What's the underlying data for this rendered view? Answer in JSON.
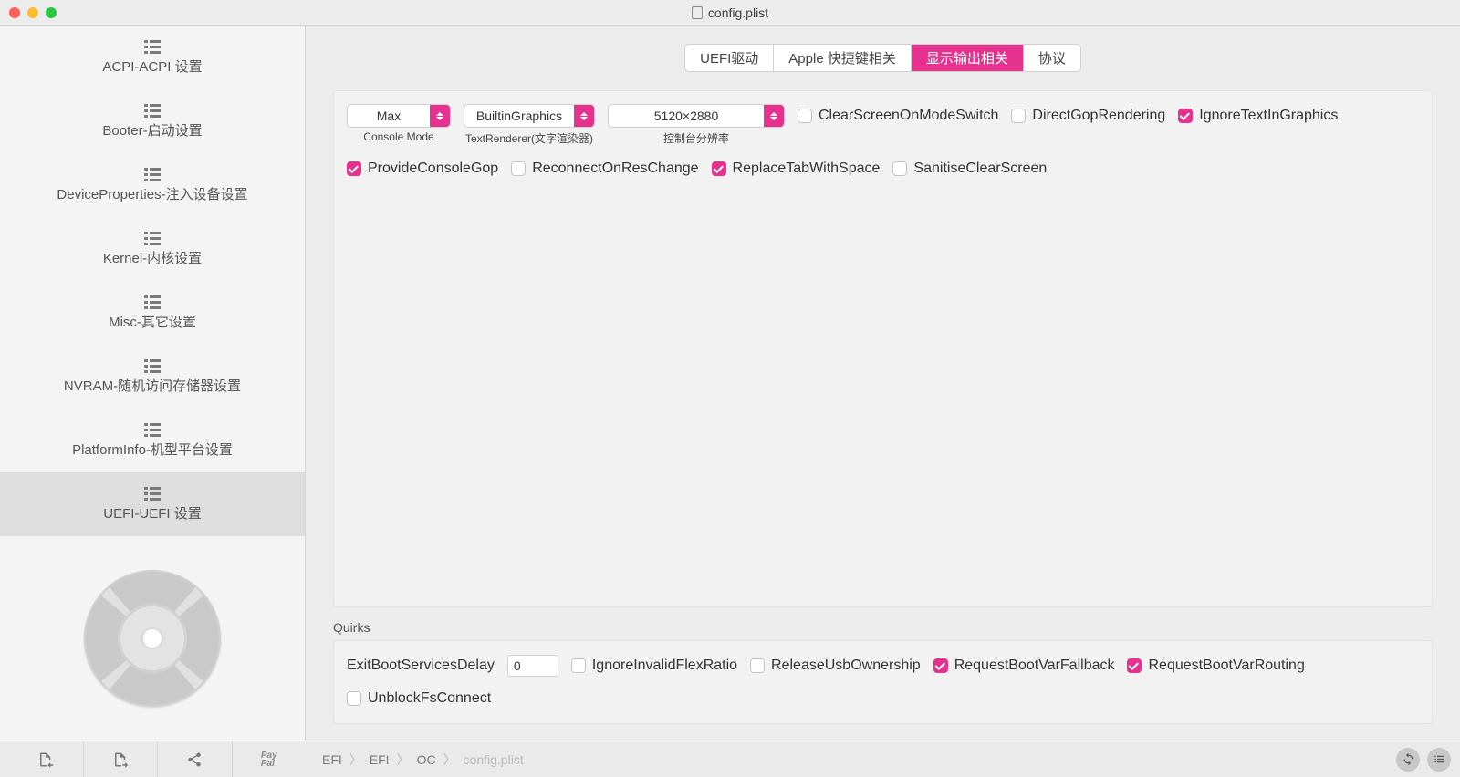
{
  "window": {
    "title": "config.plist"
  },
  "sidebar": {
    "items": [
      {
        "label": "ACPI-ACPI 设置"
      },
      {
        "label": "Booter-启动设置"
      },
      {
        "label": "DeviceProperties-注入设备设置"
      },
      {
        "label": "Kernel-内核设置"
      },
      {
        "label": "Misc-其它设置"
      },
      {
        "label": "NVRAM-随机访问存储器设置"
      },
      {
        "label": "PlatformInfo-机型平台设置"
      },
      {
        "label": "UEFI-UEFI 设置"
      }
    ],
    "active_index": 7
  },
  "tabs": {
    "items": [
      {
        "label": "UEFI驱动"
      },
      {
        "label": "Apple 快捷键相关"
      },
      {
        "label": "显示输出相关"
      },
      {
        "label": "协议"
      }
    ],
    "active_index": 2
  },
  "output": {
    "console_mode": {
      "value": "Max",
      "label": "Console Mode"
    },
    "text_renderer": {
      "value": "BuiltinGraphics",
      "label": "TextRenderer(文字渲染器)"
    },
    "resolution": {
      "value": "5120×2880",
      "label": "控制台分辨率"
    },
    "checks": {
      "ClearScreenOnModeSwitch": {
        "label": "ClearScreenOnModeSwitch",
        "checked": false
      },
      "DirectGopRendering": {
        "label": "DirectGopRendering",
        "checked": false
      },
      "IgnoreTextInGraphics": {
        "label": "IgnoreTextInGraphics",
        "checked": true
      },
      "ProvideConsoleGop": {
        "label": "ProvideConsoleGop",
        "checked": true
      },
      "ReconnectOnResChange": {
        "label": "ReconnectOnResChange",
        "checked": false
      },
      "ReplaceTabWithSpace": {
        "label": "ReplaceTabWithSpace",
        "checked": true
      },
      "SanitiseClearScreen": {
        "label": "SanitiseClearScreen",
        "checked": false
      }
    }
  },
  "quirks": {
    "section_label": "Quirks",
    "exit_delay_label": "ExitBootServicesDelay",
    "exit_delay_value": "0",
    "checks": {
      "IgnoreInvalidFlexRatio": {
        "label": "IgnoreInvalidFlexRatio",
        "checked": false
      },
      "ReleaseUsbOwnership": {
        "label": "ReleaseUsbOwnership",
        "checked": false
      },
      "RequestBootVarFallback": {
        "label": "RequestBootVarFallback",
        "checked": true
      },
      "RequestBootVarRouting": {
        "label": "RequestBootVarRouting",
        "checked": true
      },
      "UnblockFsConnect": {
        "label": "UnblockFsConnect",
        "checked": false
      }
    }
  },
  "footer": {
    "crumbs": [
      "EFI",
      "EFI",
      "OC",
      "config.plist"
    ],
    "paypal": "Pay\nPal"
  }
}
